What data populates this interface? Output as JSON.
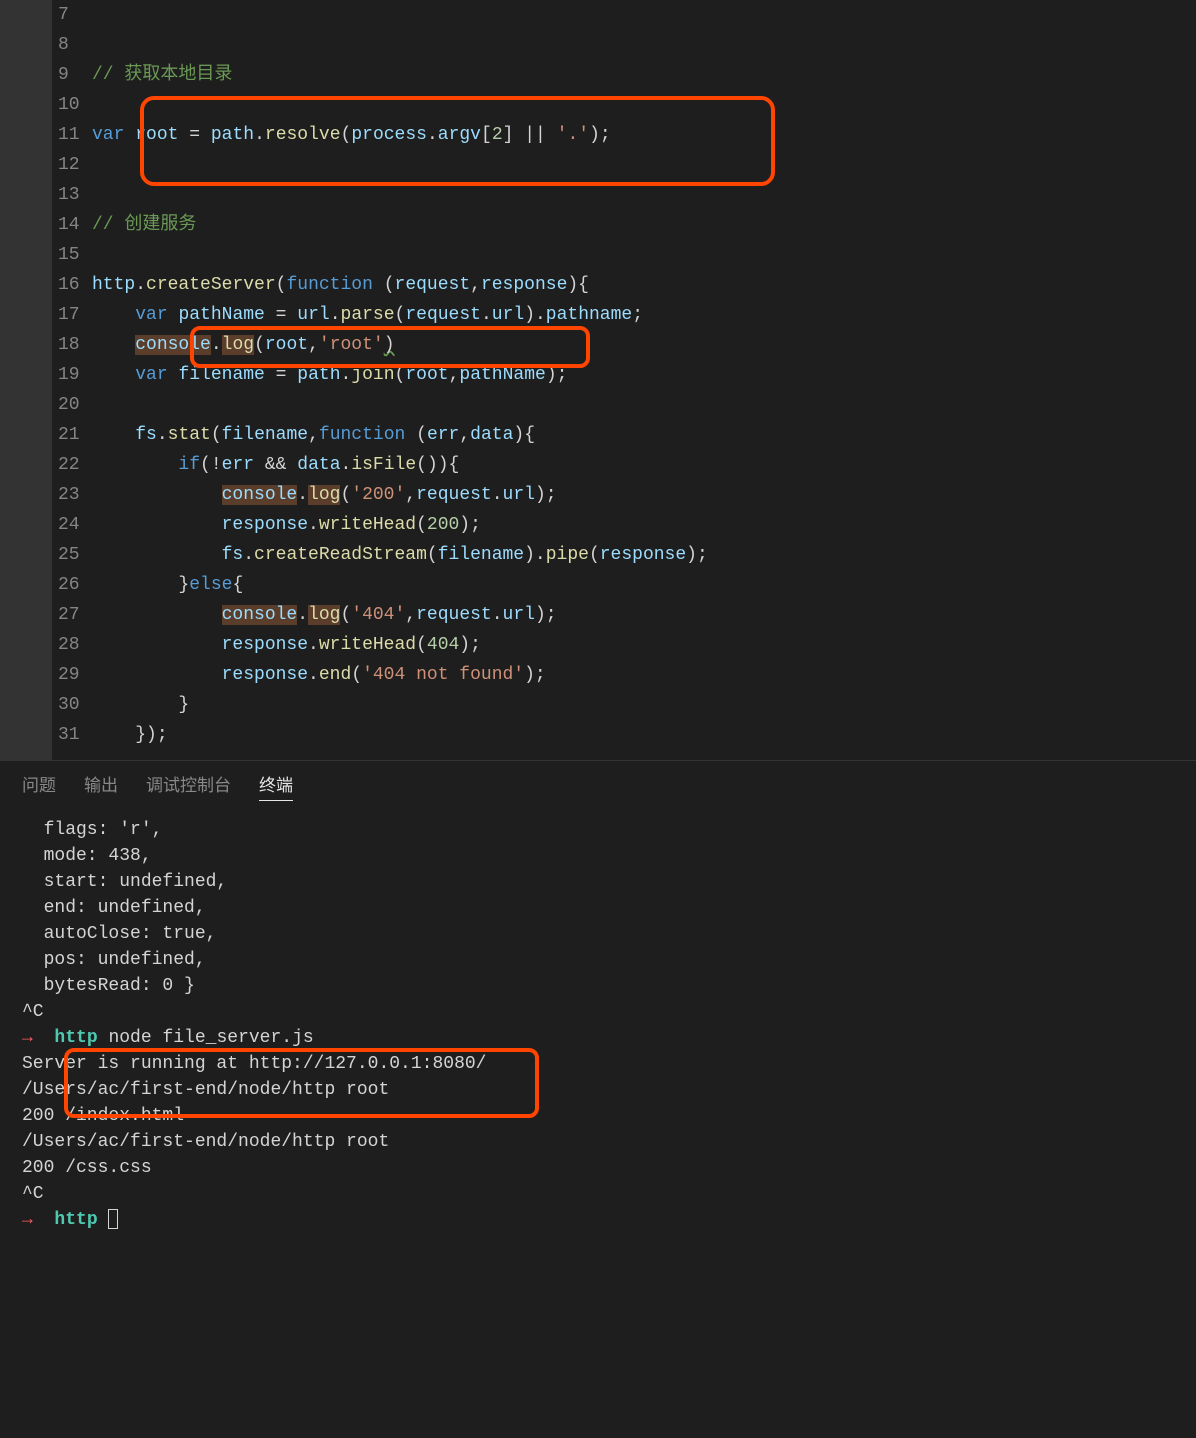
{
  "lines": {
    "7": "7",
    "8": "8",
    "9": "9",
    "10": "10",
    "11": "11",
    "12": "12",
    "13": "13",
    "14": "14",
    "15": "15",
    "16": "16",
    "17": "17",
    "18": "18",
    "19": "19",
    "20": "20",
    "21": "21",
    "22": "22",
    "23": "23",
    "24": "24",
    "25": "25",
    "26": "26",
    "27": "27",
    "28": "28",
    "29": "29",
    "30": "30",
    "31": "31"
  },
  "code": {
    "c9": "// 获取本地目录",
    "c14": "// 创建服务",
    "kw_var": "var",
    "kw_function": "function",
    "kw_if": "if",
    "kw_else": "else",
    "id_root": "root",
    "id_path": "path",
    "fn_resolve": "resolve",
    "id_process": "process",
    "id_argv": "argv",
    "num_2": "2",
    "str_dot": "'.'",
    "id_http": "http",
    "fn_createServer": "createServer",
    "id_request": "request",
    "id_response": "response",
    "id_pathName": "pathName",
    "id_url": "url",
    "fn_parse": "parse",
    "prop_url": "url",
    "prop_pathname": "pathname",
    "id_console": "console",
    "fn_log": "log",
    "str_root": "'root'",
    "id_filename": "filename",
    "fn_join": "join",
    "id_fs": "fs",
    "fn_stat": "stat",
    "id_err": "err",
    "id_data": "data",
    "op_not": "!",
    "op_and": "&&",
    "fn_isFile": "isFile",
    "str_200": "'200'",
    "fn_writeHead": "writeHead",
    "num_200": "200",
    "fn_createReadStream": "createReadStream",
    "fn_pipe": "pipe",
    "str_404": "'404'",
    "num_404": "404",
    "fn_end": "end",
    "str_404nf": "'404 not found'"
  },
  "tabs": {
    "problems": "问题",
    "output": "输出",
    "debug": "调试控制台",
    "terminal": "终端"
  },
  "terminal": {
    "l1": "  flags: 'r',",
    "l2": "  mode: 438,",
    "l3": "  start: undefined,",
    "l4": "  end: undefined,",
    "l5": "  autoClose: true,",
    "l6": "  pos: undefined,",
    "l7": "  bytesRead: 0 }",
    "l8": "^C",
    "arrow": "→",
    "http": "http",
    "cmd": " node file_server.js",
    "l10": "Server is running at http://127.0.0.1:8080/",
    "l11": "/Users/ac/first-end/node/http root",
    "l12": "200 /index.html",
    "l13": "/Users/ac/first-end/node/http root",
    "l14": "200 /css.css",
    "l15": "^C"
  }
}
